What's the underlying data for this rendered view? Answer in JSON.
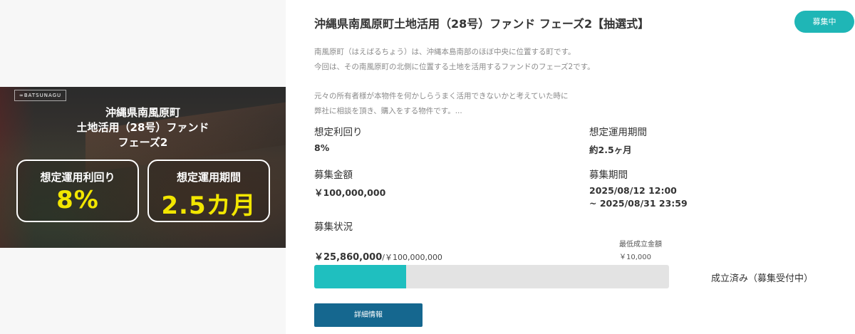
{
  "banner": {
    "logo_text": "∞BATSUNAGU",
    "title_line1": "沖縄県南風原町",
    "title_line2": "土地活用（28号）ファンド",
    "title_line3": "フェーズ2",
    "yield_label": "想定運用利回り",
    "yield_value": "8%",
    "period_label": "想定運用期間",
    "period_value": "2.5カ月"
  },
  "fund": {
    "title": "沖縄県南風原町土地活用（28号）ファンド フェーズ2【抽選式】",
    "status_badge": "募集中",
    "description": [
      "南風原町（はえばるちょう）は、沖縄本島南部のほぼ中央に位置する町です。",
      "今回は、その南風原町の北側に位置する土地を活用するファンドのフェーズ2です。",
      "元々の所有者様が本物件を何かしらうまく活用できないかと考えていた時に",
      "弊社に相談を頂き、購入をする物件です。..."
    ]
  },
  "details": {
    "yield_label": "想定利回り",
    "yield_value": "8%",
    "period_label": "想定運用期間",
    "period_value": "約2.5ヶ月",
    "amount_label": "募集金額",
    "amount_value": "￥100,000,000",
    "recruit_period_label": "募集期間",
    "recruit_period_start": "2025/08/12 12:00",
    "recruit_period_end": "~ 2025/08/31 23:59",
    "status_label": "募集状況",
    "min_amount_label": "最低成立金額",
    "min_amount_value": "￥10,000",
    "raised_amount": "￥25,860,000",
    "target_amount": "/￥100,000,000",
    "progress_fraction": 0.2586,
    "progress_status": "成立済み（募集受付中）",
    "detail_button_label": "詳細情報"
  },
  "colors": {
    "accent": "#1fb6b6",
    "progress_fill": "#1fbfbf",
    "button": "#15678f",
    "banner_value": "#f2e600"
  }
}
